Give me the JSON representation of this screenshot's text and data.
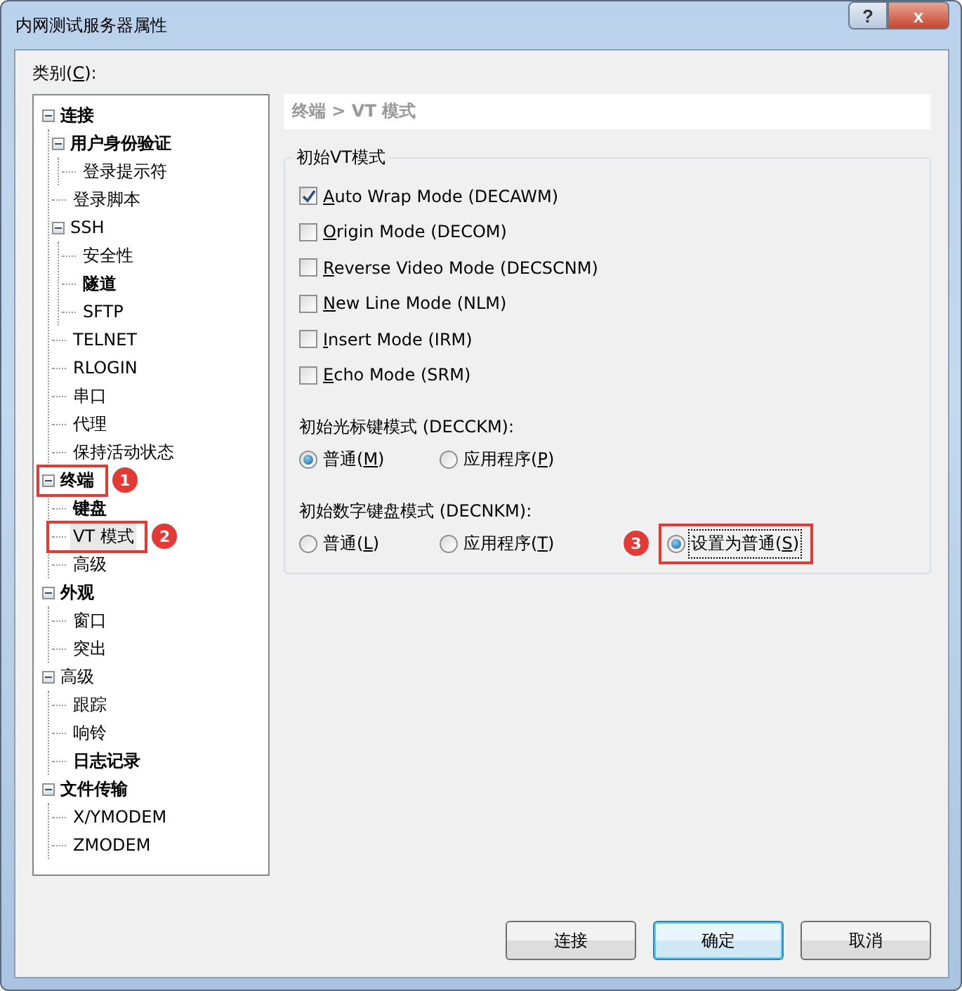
{
  "window": {
    "title": "内网测试服务器属性",
    "help_button": "?",
    "close_button": "x"
  },
  "category_label": {
    "before": "类别(",
    "accel": "C",
    "after": "):"
  },
  "tree": [
    {
      "label": "连接",
      "bold": true,
      "expanded": true,
      "selected": false,
      "children": [
        {
          "label": "用户身份验证",
          "bold": true,
          "expanded": true,
          "selected": false,
          "children": [
            {
              "label": "登录提示符",
              "bold": false,
              "selected": false
            }
          ]
        },
        {
          "label": "登录脚本",
          "bold": false,
          "selected": false
        },
        {
          "label": "SSH",
          "bold": false,
          "expanded": true,
          "selected": false,
          "children": [
            {
              "label": "安全性",
              "bold": false,
              "selected": false
            },
            {
              "label": "隧道",
              "bold": true,
              "selected": false
            },
            {
              "label": "SFTP",
              "bold": false,
              "selected": false
            }
          ]
        },
        {
          "label": "TELNET",
          "bold": false,
          "selected": false
        },
        {
          "label": "RLOGIN",
          "bold": false,
          "selected": false
        },
        {
          "label": "串口",
          "bold": false,
          "selected": false
        },
        {
          "label": "代理",
          "bold": false,
          "selected": false
        },
        {
          "label": "保持活动状态",
          "bold": false,
          "selected": false
        }
      ]
    },
    {
      "label": "终端",
      "bold": true,
      "expanded": true,
      "selected": false,
      "badge": "1",
      "children": [
        {
          "label": "键盘",
          "bold": true,
          "selected": false
        },
        {
          "label": "VT 模式",
          "bold": false,
          "selected": true,
          "badge": "2"
        },
        {
          "label": "高级",
          "bold": false,
          "selected": false
        }
      ]
    },
    {
      "label": "外观",
      "bold": true,
      "expanded": true,
      "selected": false,
      "children": [
        {
          "label": "窗口",
          "bold": false,
          "selected": false
        },
        {
          "label": "突出",
          "bold": false,
          "selected": false
        }
      ]
    },
    {
      "label": "高级",
      "bold": false,
      "expanded": true,
      "selected": false,
      "children": [
        {
          "label": "跟踪",
          "bold": false,
          "selected": false
        },
        {
          "label": "响铃",
          "bold": false,
          "selected": false
        },
        {
          "label": "日志记录",
          "bold": true,
          "selected": false
        }
      ]
    },
    {
      "label": "文件传输",
      "bold": true,
      "expanded": true,
      "selected": false,
      "children": [
        {
          "label": "X/YMODEM",
          "bold": false,
          "selected": false
        },
        {
          "label": "ZMODEM",
          "bold": false,
          "selected": false
        }
      ]
    }
  ],
  "breadcrumb": "终端 > VT 模式",
  "group_title": "初始VT模式",
  "checkboxes": [
    {
      "accel": "A",
      "after": "uto Wrap Mode (DECAWM)",
      "checked": true
    },
    {
      "accel": "O",
      "after": "rigin Mode (DECOM)",
      "checked": false
    },
    {
      "accel": "R",
      "after": "everse Video Mode (DECSCNM)",
      "checked": false
    },
    {
      "accel": "N",
      "after": "ew Line Mode (NLM)",
      "checked": false
    },
    {
      "accel": "I",
      "after": "nsert Mode (IRM)",
      "checked": false
    },
    {
      "accel": "E",
      "after": "cho Mode (SRM)",
      "checked": false
    }
  ],
  "radio_groups": [
    {
      "title": "初始光标键模式 (DECCKM):",
      "options": [
        {
          "before": "普通(",
          "accel": "M",
          "after": ")",
          "selected": true
        },
        {
          "before": "应用程序(",
          "accel": "P",
          "after": ")",
          "selected": false
        }
      ]
    },
    {
      "title": "初始数字键盘模式 (DECNKM):",
      "options": [
        {
          "before": "普通(",
          "accel": "L",
          "after": ")",
          "selected": false
        },
        {
          "before": "应用程序(",
          "accel": "T",
          "after": ")",
          "selected": false
        },
        {
          "before": "设置为普通(",
          "accel": "S",
          "after": ")",
          "selected": true,
          "focused": true,
          "badge": "3"
        }
      ]
    }
  ],
  "buttons": [
    {
      "label": "连接",
      "default": false
    },
    {
      "label": "确定",
      "default": true
    },
    {
      "label": "取消",
      "default": false
    }
  ]
}
